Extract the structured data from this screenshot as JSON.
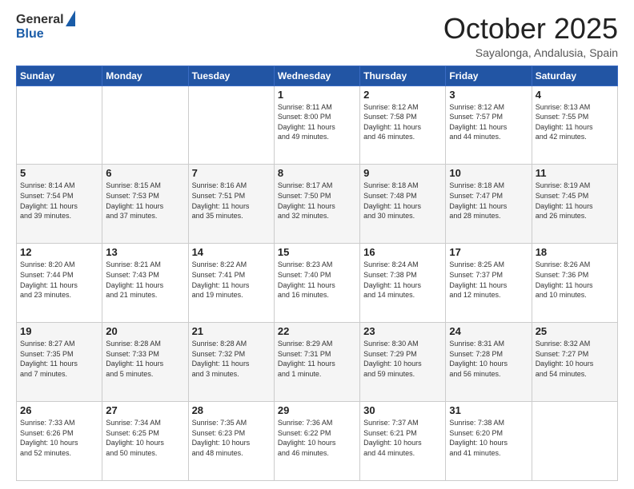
{
  "header": {
    "logo_general": "General",
    "logo_blue": "Blue",
    "month": "October 2025",
    "location": "Sayalonga, Andalusia, Spain"
  },
  "days_of_week": [
    "Sunday",
    "Monday",
    "Tuesday",
    "Wednesday",
    "Thursday",
    "Friday",
    "Saturday"
  ],
  "weeks": [
    [
      {
        "day": "",
        "info": ""
      },
      {
        "day": "",
        "info": ""
      },
      {
        "day": "",
        "info": ""
      },
      {
        "day": "1",
        "info": "Sunrise: 8:11 AM\nSunset: 8:00 PM\nDaylight: 11 hours\nand 49 minutes."
      },
      {
        "day": "2",
        "info": "Sunrise: 8:12 AM\nSunset: 7:58 PM\nDaylight: 11 hours\nand 46 minutes."
      },
      {
        "day": "3",
        "info": "Sunrise: 8:12 AM\nSunset: 7:57 PM\nDaylight: 11 hours\nand 44 minutes."
      },
      {
        "day": "4",
        "info": "Sunrise: 8:13 AM\nSunset: 7:55 PM\nDaylight: 11 hours\nand 42 minutes."
      }
    ],
    [
      {
        "day": "5",
        "info": "Sunrise: 8:14 AM\nSunset: 7:54 PM\nDaylight: 11 hours\nand 39 minutes."
      },
      {
        "day": "6",
        "info": "Sunrise: 8:15 AM\nSunset: 7:53 PM\nDaylight: 11 hours\nand 37 minutes."
      },
      {
        "day": "7",
        "info": "Sunrise: 8:16 AM\nSunset: 7:51 PM\nDaylight: 11 hours\nand 35 minutes."
      },
      {
        "day": "8",
        "info": "Sunrise: 8:17 AM\nSunset: 7:50 PM\nDaylight: 11 hours\nand 32 minutes."
      },
      {
        "day": "9",
        "info": "Sunrise: 8:18 AM\nSunset: 7:48 PM\nDaylight: 11 hours\nand 30 minutes."
      },
      {
        "day": "10",
        "info": "Sunrise: 8:18 AM\nSunset: 7:47 PM\nDaylight: 11 hours\nand 28 minutes."
      },
      {
        "day": "11",
        "info": "Sunrise: 8:19 AM\nSunset: 7:45 PM\nDaylight: 11 hours\nand 26 minutes."
      }
    ],
    [
      {
        "day": "12",
        "info": "Sunrise: 8:20 AM\nSunset: 7:44 PM\nDaylight: 11 hours\nand 23 minutes."
      },
      {
        "day": "13",
        "info": "Sunrise: 8:21 AM\nSunset: 7:43 PM\nDaylight: 11 hours\nand 21 minutes."
      },
      {
        "day": "14",
        "info": "Sunrise: 8:22 AM\nSunset: 7:41 PM\nDaylight: 11 hours\nand 19 minutes."
      },
      {
        "day": "15",
        "info": "Sunrise: 8:23 AM\nSunset: 7:40 PM\nDaylight: 11 hours\nand 16 minutes."
      },
      {
        "day": "16",
        "info": "Sunrise: 8:24 AM\nSunset: 7:38 PM\nDaylight: 11 hours\nand 14 minutes."
      },
      {
        "day": "17",
        "info": "Sunrise: 8:25 AM\nSunset: 7:37 PM\nDaylight: 11 hours\nand 12 minutes."
      },
      {
        "day": "18",
        "info": "Sunrise: 8:26 AM\nSunset: 7:36 PM\nDaylight: 11 hours\nand 10 minutes."
      }
    ],
    [
      {
        "day": "19",
        "info": "Sunrise: 8:27 AM\nSunset: 7:35 PM\nDaylight: 11 hours\nand 7 minutes."
      },
      {
        "day": "20",
        "info": "Sunrise: 8:28 AM\nSunset: 7:33 PM\nDaylight: 11 hours\nand 5 minutes."
      },
      {
        "day": "21",
        "info": "Sunrise: 8:28 AM\nSunset: 7:32 PM\nDaylight: 11 hours\nand 3 minutes."
      },
      {
        "day": "22",
        "info": "Sunrise: 8:29 AM\nSunset: 7:31 PM\nDaylight: 11 hours\nand 1 minute."
      },
      {
        "day": "23",
        "info": "Sunrise: 8:30 AM\nSunset: 7:29 PM\nDaylight: 10 hours\nand 59 minutes."
      },
      {
        "day": "24",
        "info": "Sunrise: 8:31 AM\nSunset: 7:28 PM\nDaylight: 10 hours\nand 56 minutes."
      },
      {
        "day": "25",
        "info": "Sunrise: 8:32 AM\nSunset: 7:27 PM\nDaylight: 10 hours\nand 54 minutes."
      }
    ],
    [
      {
        "day": "26",
        "info": "Sunrise: 7:33 AM\nSunset: 6:26 PM\nDaylight: 10 hours\nand 52 minutes."
      },
      {
        "day": "27",
        "info": "Sunrise: 7:34 AM\nSunset: 6:25 PM\nDaylight: 10 hours\nand 50 minutes."
      },
      {
        "day": "28",
        "info": "Sunrise: 7:35 AM\nSunset: 6:23 PM\nDaylight: 10 hours\nand 48 minutes."
      },
      {
        "day": "29",
        "info": "Sunrise: 7:36 AM\nSunset: 6:22 PM\nDaylight: 10 hours\nand 46 minutes."
      },
      {
        "day": "30",
        "info": "Sunrise: 7:37 AM\nSunset: 6:21 PM\nDaylight: 10 hours\nand 44 minutes."
      },
      {
        "day": "31",
        "info": "Sunrise: 7:38 AM\nSunset: 6:20 PM\nDaylight: 10 hours\nand 41 minutes."
      },
      {
        "day": "",
        "info": ""
      }
    ]
  ]
}
